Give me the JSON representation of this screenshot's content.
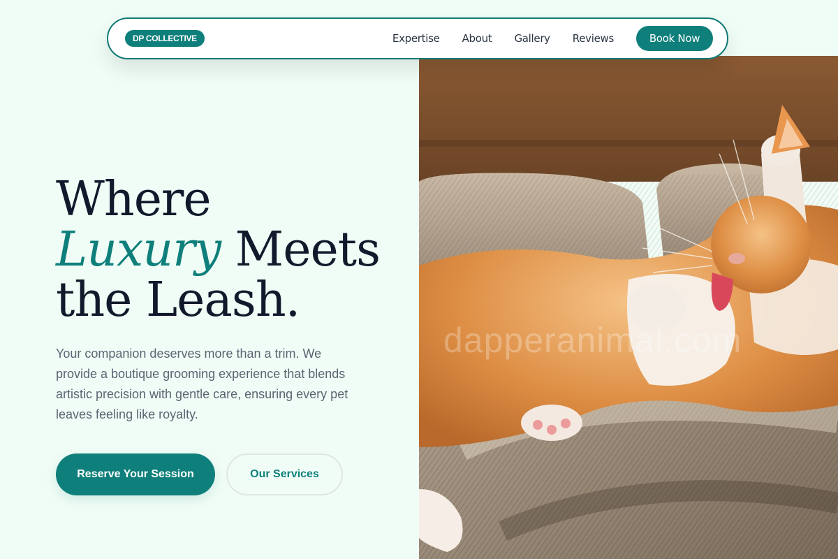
{
  "nav": {
    "logo": "DP COLLECTIVE",
    "links": [
      "Expertise",
      "About",
      "Gallery",
      "Reviews"
    ],
    "cta": "Book Now"
  },
  "hero": {
    "title_line1": "Where",
    "title_accent": "Luxury",
    "title_line2_rest": " Meets",
    "title_line3": "the Leash.",
    "description": "Your companion deserves more than a trim. We provide a boutique grooming experience that blends artistic precision with gentle care, ensuring every pet leaves feeling like royalty.",
    "primary_cta": "Reserve Your Session",
    "secondary_cta": "Our Services",
    "image_watermark": "dapperanimal.com"
  },
  "colors": {
    "accent": "#0f7f7b",
    "background": "#f0fdf6",
    "heading": "#111a2c",
    "body_text": "#5b6472"
  }
}
